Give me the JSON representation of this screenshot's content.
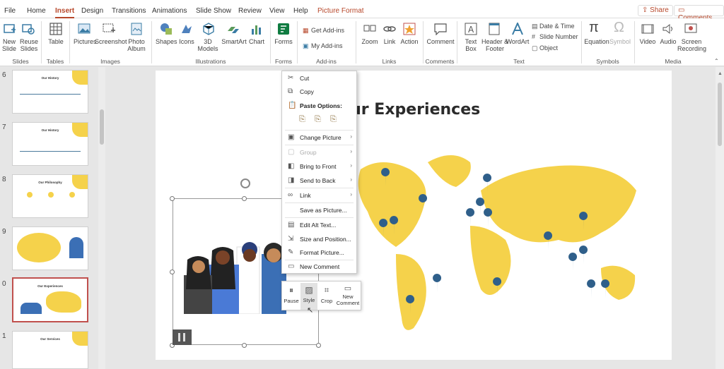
{
  "tabs": [
    "File",
    "Home",
    "Insert",
    "Design",
    "Transitions",
    "Animations",
    "Slide Show",
    "Review",
    "View",
    "Help",
    "Picture Format"
  ],
  "share": "Share",
  "comments": "Comments",
  "ribbon": {
    "new_slide": "New Slide",
    "reuse_slides": "Reuse Slides",
    "table": "Table",
    "pictures": "Pictures",
    "screenshot": "Screenshot",
    "photo_album": "Photo Album",
    "shapes": "Shapes",
    "icons": "Icons",
    "models3d": "3D Models",
    "smartart": "SmartArt",
    "chart": "Chart",
    "forms": "Forms",
    "get_addins": "Get Add-ins",
    "my_addins": "My Add-ins",
    "zoom": "Zoom",
    "link": "Link",
    "action": "Action",
    "comment": "Comment",
    "text_box": "Text Box",
    "header_footer": "Header & Footer",
    "wordart": "WordArt",
    "date_time": "Date & Time",
    "slide_number": "Slide Number",
    "object": "Object",
    "equation": "Equation",
    "symbol": "Symbol",
    "video": "Video",
    "audio": "Audio",
    "screen_recording": "Screen Recording",
    "groups": [
      "Slides",
      "Tables",
      "Images",
      "Illustrations",
      "Forms",
      "Add-ins",
      "Links",
      "Comments",
      "Text",
      "Symbols",
      "Media"
    ]
  },
  "thumbnails": [
    {
      "num": "6",
      "title": "Our History"
    },
    {
      "num": "7",
      "title": "Our History"
    },
    {
      "num": "8",
      "title": "Our Philosophy"
    },
    {
      "num": "9",
      "title": ""
    },
    {
      "num": "0",
      "title": "Our Experiences"
    },
    {
      "num": "1",
      "title": "Our Services"
    }
  ],
  "slide": {
    "title": "our Experiences"
  },
  "context_menu": [
    {
      "label": "Cut",
      "icon": "scissors-icon",
      "disabled": false,
      "arrow": false
    },
    {
      "label": "Copy",
      "icon": "copy-icon",
      "disabled": false,
      "arrow": false
    },
    {
      "label": "Paste Options:",
      "icon": "clipboard-icon",
      "disabled": false,
      "arrow": false,
      "bold": true
    },
    {
      "label": "Change Picture",
      "icon": "change-picture-icon",
      "disabled": false,
      "arrow": true
    },
    {
      "label": "Group",
      "icon": "group-icon",
      "disabled": true,
      "arrow": true
    },
    {
      "label": "Bring to Front",
      "icon": "bring-front-icon",
      "disabled": false,
      "arrow": true
    },
    {
      "label": "Send to Back",
      "icon": "send-back-icon",
      "disabled": false,
      "arrow": true
    },
    {
      "label": "Link",
      "icon": "link-icon",
      "disabled": false,
      "arrow": true
    },
    {
      "label": "Save as Picture...",
      "icon": "",
      "disabled": false,
      "arrow": false
    },
    {
      "label": "Edit Alt Text...",
      "icon": "alt-text-icon",
      "disabled": false,
      "arrow": false
    },
    {
      "label": "Size and Position...",
      "icon": "size-position-icon",
      "disabled": false,
      "arrow": false
    },
    {
      "label": "Format Picture...",
      "icon": "format-picture-icon",
      "disabled": false,
      "arrow": false
    },
    {
      "label": "New Comment",
      "icon": "new-comment-icon",
      "disabled": false,
      "arrow": false
    }
  ],
  "mini_toolbar": [
    "Pause",
    "Style",
    "Crop",
    "New Comment"
  ],
  "colors": {
    "accent": "#b7472a",
    "map": "#f5d24b",
    "pin": "#2f5f8a"
  }
}
